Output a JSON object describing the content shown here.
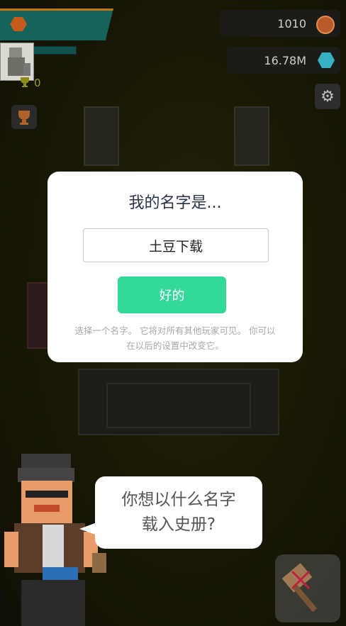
{
  "hud": {
    "trophy_count": "0",
    "coins": "1010",
    "gems": "16.78M",
    "icons": {
      "banner": "hexagon-badge-icon",
      "trophy": "trophy-icon",
      "coin": "coin-icon",
      "gem": "gem-icon",
      "settings": "gear-icon",
      "hammer": "hammer-icon"
    }
  },
  "dialog": {
    "title": "我的名字是...",
    "name_value": "土豆下载",
    "ok_label": "好的",
    "hint": "选择一个名字。 它将对所有其他玩家可见。 你可以\n在以后的设置中改变它。"
  },
  "speech": {
    "text": "你想以什么名字\n载入史册?"
  },
  "colors": {
    "accent_green": "#33d998",
    "banner_teal": "#15635a",
    "banner_orange": "#c2761a",
    "title_text": "#2b3347"
  }
}
